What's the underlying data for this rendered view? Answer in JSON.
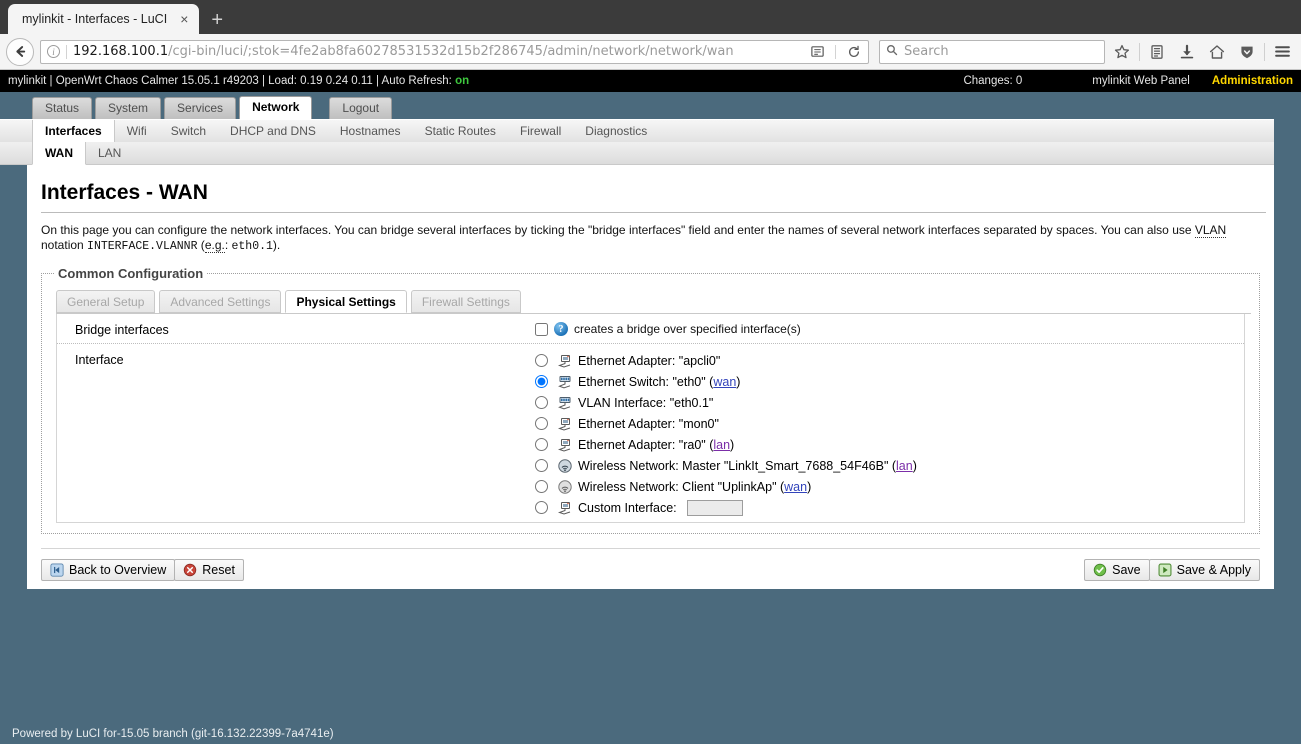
{
  "browser": {
    "tab_title": "mylinkit - Interfaces - LuCI",
    "tab_close_label": "×",
    "new_tab_label": "+",
    "url_host": "192.168.100.1",
    "url_path": "/cgi-bin/luci/;stok=4fe2ab8fa60278531532d15b2f286745/admin/network/network/wan",
    "search_placeholder": "Search",
    "icons": {
      "back": "back-arrow-icon",
      "info": "i",
      "reader": "reader-view-icon",
      "reload": "⟳",
      "search": "search-icon",
      "bookmark": "star-icon",
      "library": "library-icon",
      "downloads": "download-arrow-icon",
      "home": "home-icon",
      "shield": "shield-icon",
      "menu": "hamburger-menu-icon"
    }
  },
  "statusbar": {
    "system_info": "mylinkit | OpenWrt Chaos Calmer 15.05.1 r49203 | Load: 0.19 0.24 0.11 | Auto Refresh:",
    "auto_refresh_state": "on",
    "changes": "Changes: 0",
    "panel_name": "mylinkit Web Panel",
    "admin_label": "Administration"
  },
  "mainmenu": [
    {
      "label": "Status",
      "active": false
    },
    {
      "label": "System",
      "active": false
    },
    {
      "label": "Services",
      "active": false
    },
    {
      "label": "Network",
      "active": true
    },
    {
      "label": "Logout",
      "active": false
    }
  ],
  "submenu": [
    {
      "label": "Interfaces",
      "active": true
    },
    {
      "label": "Wifi",
      "active": false
    },
    {
      "label": "Switch",
      "active": false
    },
    {
      "label": "DHCP and DNS",
      "active": false
    },
    {
      "label": "Hostnames",
      "active": false
    },
    {
      "label": "Static Routes",
      "active": false
    },
    {
      "label": "Firewall",
      "active": false
    },
    {
      "label": "Diagnostics",
      "active": false
    }
  ],
  "subsubmenu": [
    {
      "label": "WAN",
      "active": true
    },
    {
      "label": "LAN",
      "active": false
    }
  ],
  "page": {
    "title": "Interfaces - WAN",
    "description_part1": "On this page you can configure the network interfaces. You can bridge several interfaces by ticking the \"bridge interfaces\" field and enter the names of several network interfaces separated by spaces. You can also use ",
    "description_vlan": "VLAN",
    "description_part2": " notation ",
    "description_mono1": "INTERFACE.VLANNR",
    "description_eg": "e.g.",
    "description_colon": ": ",
    "description_mono2": "eth0.1",
    "description_end": ")."
  },
  "common_config": {
    "legend": "Common Configuration",
    "tabs": [
      {
        "label": "General Setup",
        "active": false
      },
      {
        "label": "Advanced Settings",
        "active": false
      },
      {
        "label": "Physical Settings",
        "active": true
      },
      {
        "label": "Firewall Settings",
        "active": false
      }
    ],
    "bridge": {
      "label": "Bridge interfaces",
      "checked": false,
      "help": "creates a bridge over specified interface(s)",
      "help_icon_glyph": "?"
    },
    "interface": {
      "label": "Interface",
      "selected_index": 1,
      "options": [
        {
          "text": "Ethernet Adapter: \"apcli0\"",
          "zone": "",
          "icon": "ethernet-adapter-icon",
          "selected": false,
          "custom": false
        },
        {
          "text": "Ethernet Switch: \"eth0\"",
          "zone": "wan",
          "icon": "ethernet-switch-icon",
          "selected": true,
          "custom": false
        },
        {
          "text": "VLAN Interface: \"eth0.1\"",
          "zone": "",
          "icon": "ethernet-switch-icon",
          "selected": false,
          "custom": false
        },
        {
          "text": "Ethernet Adapter: \"mon0\"",
          "zone": "",
          "icon": "ethernet-adapter-icon",
          "selected": false,
          "custom": false
        },
        {
          "text": "Ethernet Adapter: \"ra0\"",
          "zone": "lan",
          "zone_visited": true,
          "icon": "ethernet-adapter-icon",
          "selected": false,
          "custom": false
        },
        {
          "text": "Wireless Network: Master \"LinkIt_Smart_7688_54F46B\"",
          "zone": "lan",
          "zone_visited": true,
          "icon": "wireless-network-icon",
          "selected": false,
          "custom": false
        },
        {
          "text": "Wireless Network: Client \"UplinkAp\"",
          "zone": "wan",
          "icon": "wireless-network-icon",
          "selected": false,
          "custom": false
        },
        {
          "text": "Custom Interface:",
          "zone": "",
          "icon": "ethernet-adapter-icon",
          "selected": false,
          "custom": true,
          "custom_value": ""
        }
      ]
    }
  },
  "footer_buttons": {
    "back_to_overview": "Back to Overview",
    "reset": "Reset",
    "save": "Save",
    "save_apply": "Save & Apply"
  },
  "powered_by": "Powered by LuCI for-15.05 branch (git-16.132.22399-7a4741e)"
}
